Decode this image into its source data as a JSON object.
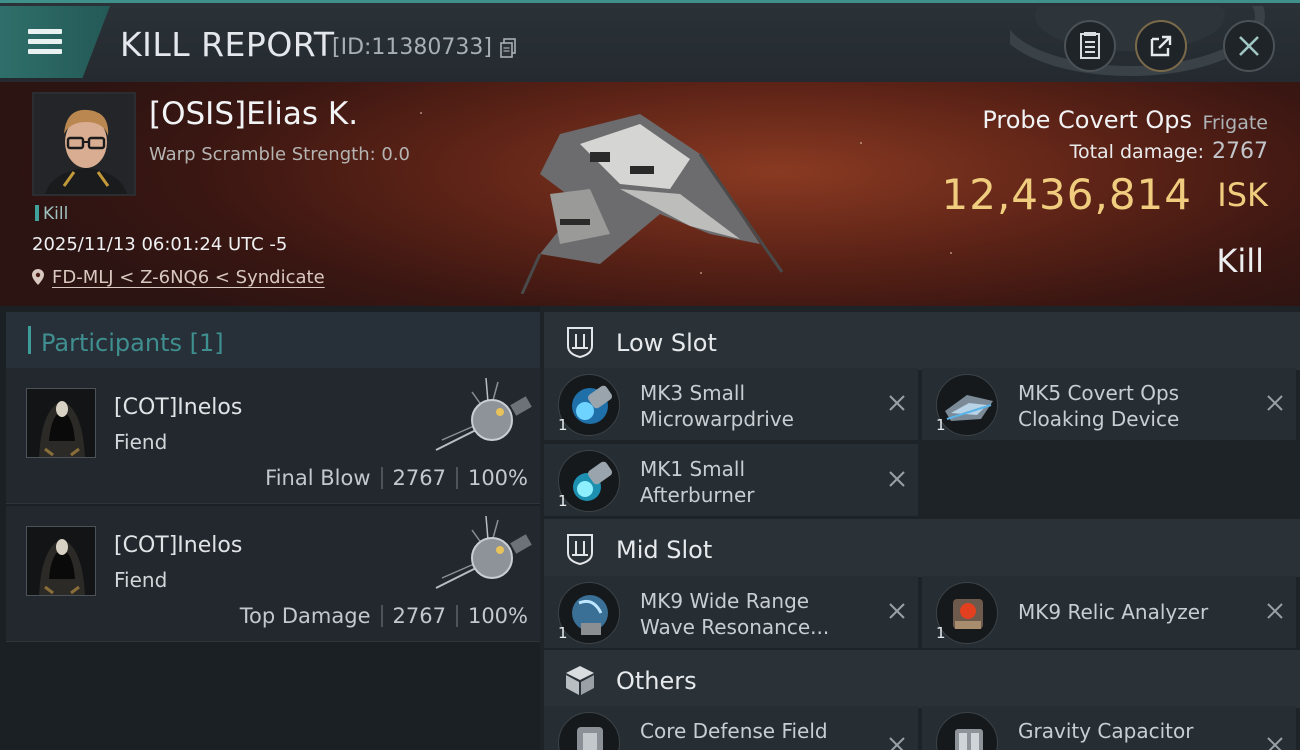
{
  "header": {
    "title": "KILL REPORT",
    "report_id": "[ID:11380733]"
  },
  "victim": {
    "name": "[OSIS]Elias K.",
    "warp_scramble": "Warp Scramble Strength: 0.0",
    "tag": "Kill",
    "timestamp": "2025/11/13 06:01:24 UTC -5",
    "location": "FD-MLJ < Z-6NQ6 < Syndicate",
    "ship_name": "Probe Covert Ops",
    "ship_class": "Frigate",
    "total_damage_label": "Total damage:",
    "total_damage": "2767",
    "isk_value": "12,436,814",
    "isk_unit": "ISK",
    "kill_type": "Kill"
  },
  "participants": {
    "title": "Participants",
    "count": "[1]",
    "rows": [
      {
        "name": "[COT]Inelos",
        "ship": "Fiend",
        "tag": "Final Blow",
        "damage": "2767",
        "percent": "100%"
      },
      {
        "name": "[COT]Inelos",
        "ship": "Fiend",
        "tag": "Top Damage",
        "damage": "2767",
        "percent": "100%"
      }
    ]
  },
  "fitting": {
    "low_slot": {
      "label": "Low Slot",
      "modules": [
        {
          "line1": "MK3 Small",
          "line2": "Microwarpdrive",
          "qty": "1"
        },
        {
          "line1": "MK5 Covert Ops",
          "line2": "Cloaking Device",
          "qty": "1"
        },
        {
          "line1": "MK1 Small",
          "line2": "Afterburner",
          "qty": "1"
        }
      ]
    },
    "mid_slot": {
      "label": "Mid Slot",
      "modules": [
        {
          "line1": "MK9 Wide Range",
          "line2": "Wave Resonance...",
          "qty": "1"
        },
        {
          "line1": "MK9 Relic Analyzer",
          "line2": "",
          "qty": "1"
        }
      ]
    },
    "others": {
      "label": "Others",
      "modules": [
        {
          "line1": "Core Defense Field",
          "line2": "",
          "qty": ""
        },
        {
          "line1": "Gravity Capacitor",
          "line2": "",
          "qty": ""
        }
      ]
    }
  },
  "colors": {
    "accent_teal": "#3f8f8a",
    "isk_gold": "#f0cd7e"
  }
}
